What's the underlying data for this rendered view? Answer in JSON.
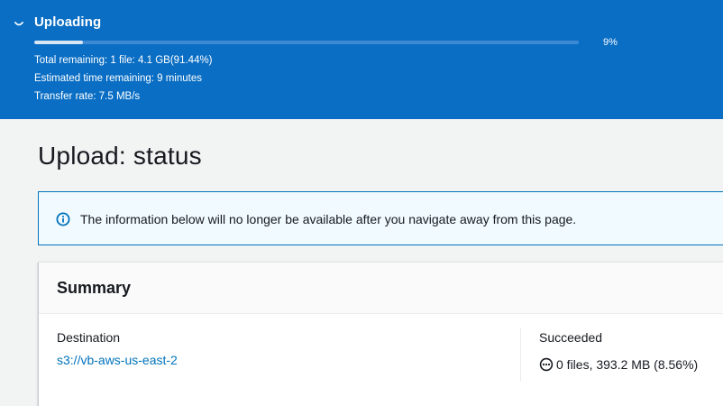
{
  "banner": {
    "title": "Uploading",
    "progress_percent_label": "9%",
    "progress_fraction": 0.09,
    "total_remaining": "Total remaining: 1 file: 4.1 GB(91.44%)",
    "estimated_time": "Estimated time remaining: 9 minutes",
    "transfer_rate": "Transfer rate: 7.5 MB/s",
    "toggle_icon": "chevron-down-icon",
    "background_color": "#0a6ec4"
  },
  "page": {
    "title": "Upload: status"
  },
  "alert": {
    "icon": "info-icon",
    "text": "The information below will no longer be available after you navigate away from this page.",
    "accent_color": "#0073bb"
  },
  "summary": {
    "title": "Summary",
    "destination_label": "Destination",
    "destination_value": "s3://vb-aws-us-east-2",
    "succeeded_label": "Succeeded",
    "succeeded_icon": "in-progress-icon",
    "succeeded_value": "0 files, 393.2 MB (8.56%)",
    "link_color": "#0073bb"
  }
}
